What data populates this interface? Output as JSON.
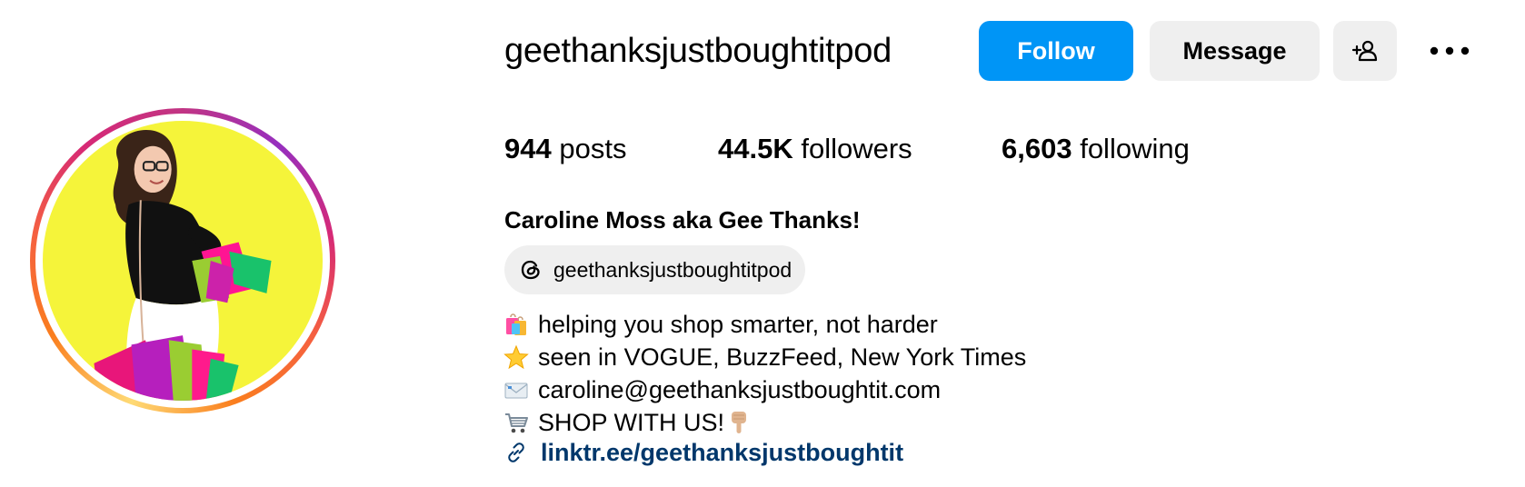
{
  "profile": {
    "username": "geethanksjustboughtitpod",
    "full_name": "Caroline Moss aka Gee Thanks!",
    "avatar_icon": "profile-photo"
  },
  "actions": {
    "follow_label": "Follow",
    "message_label": "Message",
    "add_user_icon": "add-person-icon",
    "more_icon": "more-options-icon"
  },
  "stats": {
    "posts_count": "944",
    "posts_label": "posts",
    "followers_count": "44.5K",
    "followers_label": "followers",
    "following_count": "6,603",
    "following_label": "following"
  },
  "threads": {
    "handle": "geethanksjustboughtitpod",
    "icon": "threads-icon"
  },
  "bio": {
    "lines": [
      {
        "emoji": "shopping-bags",
        "text": "helping you shop smarter, not harder"
      },
      {
        "emoji": "star",
        "text": "seen in VOGUE, BuzzFeed, New York Times"
      },
      {
        "emoji": "envelope",
        "text": "caroline@geethanksjustboughtit.com"
      },
      {
        "emoji": "shopping-cart",
        "text": "SHOP WITH US!",
        "suffix_emoji": "pointing-down"
      }
    ],
    "link_text": "linktr.ee/geethanksjustboughtit",
    "link_icon": "link-icon"
  },
  "colors": {
    "follow_button": "#0095f6",
    "secondary_button": "#efefef",
    "link": "#00376b",
    "avatar_background": "#f5f43a"
  }
}
